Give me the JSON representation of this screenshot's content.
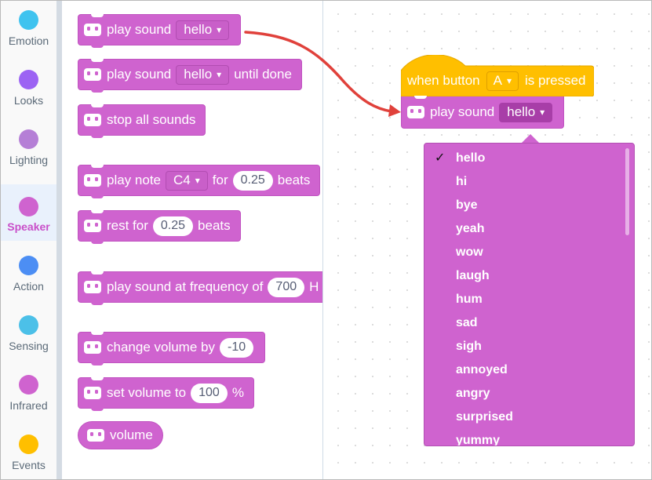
{
  "categories": [
    {
      "label": "Emotion",
      "color": "#3fc3ef"
    },
    {
      "label": "Looks",
      "color": "#9c63f3"
    },
    {
      "label": "Lighting",
      "color": "#b57fd6"
    },
    {
      "label": "Speaker",
      "color": "#cf63cf",
      "selected": true
    },
    {
      "label": "Action",
      "color": "#4c8ef4"
    },
    {
      "label": "Sensing",
      "color": "#4cc0e8"
    },
    {
      "label": "Infrared",
      "color": "#cf63cf"
    },
    {
      "label": "Events",
      "color": "#ffbf00"
    }
  ],
  "flyout": {
    "play_sound": {
      "label": "play sound",
      "value": "hello"
    },
    "play_sound_until_done": {
      "label": "play sound",
      "value": "hello",
      "suffix": "until done"
    },
    "stop_all_sounds": {
      "label": "stop all sounds"
    },
    "play_note": {
      "label": "play note",
      "note": "C4",
      "for": "for",
      "beats_value": "0.25",
      "beats": "beats"
    },
    "rest_for": {
      "label": "rest for",
      "value": "0.25",
      "beats": "beats"
    },
    "play_frequency": {
      "label": "play sound at frequency of",
      "value": "700",
      "suffix": "H"
    },
    "change_volume": {
      "label": "change volume by",
      "value": "-10"
    },
    "set_volume": {
      "label": "set volume to",
      "value": "100",
      "suffix": "%"
    },
    "volume_reporter": {
      "label": "volume"
    }
  },
  "workspace": {
    "hat": {
      "label_before": "when button",
      "value": "A",
      "label_after": "is pressed"
    },
    "play_sound": {
      "label": "play sound",
      "value": "hello"
    }
  },
  "menu": {
    "selected": "hello",
    "items": [
      "hello",
      "hi",
      "bye",
      "yeah",
      "wow",
      "laugh",
      "hum",
      "sad",
      "sigh",
      "annoyed",
      "angry",
      "surprised",
      "yummy"
    ]
  },
  "icons": {
    "dropdown_arrow": "▾",
    "check": "✓"
  },
  "colors": {
    "speaker": "#cf63cf",
    "events": "#ffbf00",
    "arrow": "#e0413b"
  }
}
